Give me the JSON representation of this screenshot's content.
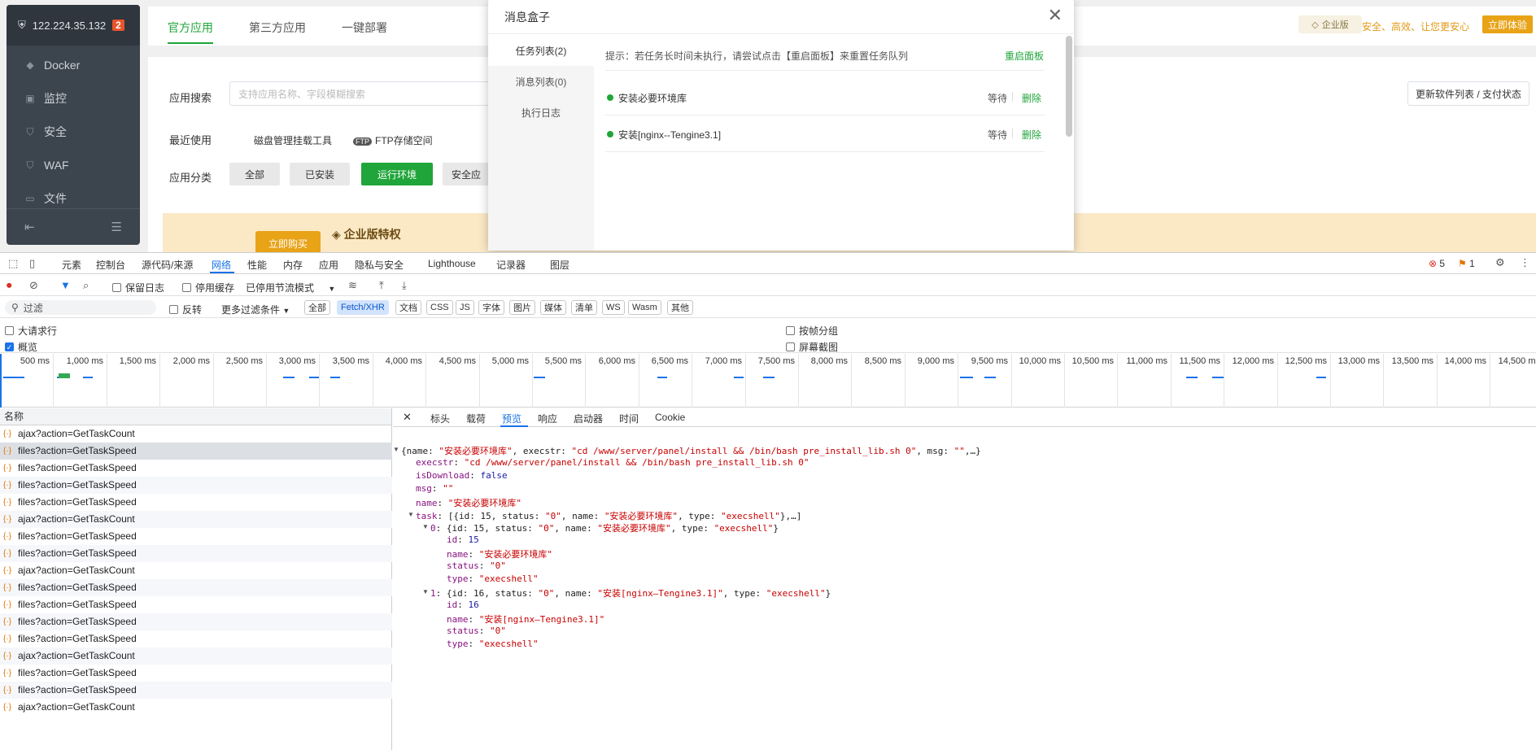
{
  "app": {
    "host": "122.224.35.132",
    "host_badge": "2",
    "nav": [
      "Docker",
      "监控",
      "安全",
      "WAF",
      "文件"
    ],
    "tabs": [
      "官方应用",
      "第三方应用",
      "一键部署"
    ],
    "ent_badge": "企业版",
    "ent_slogan": "安全、高效、让您更安心",
    "ent_button": "立即体验",
    "search_label": "应用搜索",
    "search_placeholder": "支持应用名称、字段模糊搜索",
    "update_button": "更新软件列表 / 支付状态",
    "recent_label": "最近使用",
    "recent": [
      "磁盘管理挂载工具",
      "FTP存储空间"
    ],
    "category_label": "应用分类",
    "categories": [
      "全部",
      "已安装",
      "运行环境",
      "安全应"
    ],
    "banner_title": "企业版特权",
    "banner_button": "立即购买"
  },
  "modal": {
    "title": "消息盒子",
    "tabs": [
      "任务列表(2)",
      "消息列表(0)",
      "执行日志"
    ],
    "tip": "提示：若任务长时间未执行，请尝试点击【重启面板】来重置任务队列",
    "restart": "重启面板",
    "tasks": [
      {
        "name": "安装必要环境库",
        "status": "等待",
        "action": "删除"
      },
      {
        "name": "安装[nginx--Tengine3.1]",
        "status": "等待",
        "action": "删除"
      }
    ]
  },
  "devtools": {
    "tabs": [
      "元素",
      "控制台",
      "源代码/来源",
      "网络",
      "性能",
      "内存",
      "应用",
      "隐私与安全",
      "Lighthouse",
      "记录器",
      "图层"
    ],
    "errors": "5",
    "warnings": "1",
    "toolbar": {
      "preserve_log": "保留日志",
      "disable_cache": "停用缓存",
      "throttle": "已停用节流模式"
    },
    "filter": {
      "placeholder": "过滤",
      "invert": "反转",
      "more": "更多过滤条件",
      "types": [
        "全部",
        "Fetch/XHR",
        "文档",
        "CSS",
        "JS",
        "字体",
        "图片",
        "媒体",
        "清单",
        "WS",
        "Wasm",
        "其他"
      ]
    },
    "options": {
      "big_rows": "大请求行",
      "overview": "概览",
      "group_frame": "按帧分组",
      "screenshots": "屏幕截图"
    },
    "timeline_labels": [
      "500 ms",
      "1,000 ms",
      "1,500 ms",
      "2,000 ms",
      "2,500 ms",
      "3,000 ms",
      "3,500 ms",
      "4,000 ms",
      "4,500 ms",
      "5,000 ms",
      "5,500 ms",
      "6,000 ms",
      "6,500 ms",
      "7,000 ms",
      "7,500 ms",
      "8,000 ms",
      "8,500 ms",
      "9,000 ms",
      "9,500 ms",
      "10,000 ms",
      "10,500 ms",
      "11,000 ms",
      "11,500 ms",
      "12,000 ms",
      "12,500 ms",
      "13,000 ms",
      "13,500 ms",
      "14,000 ms",
      "14,500 ms"
    ],
    "name_header": "名称",
    "requests": [
      "ajax?action=GetTaskCount",
      "files?action=GetTaskSpeed",
      "files?action=GetTaskSpeed",
      "files?action=GetTaskSpeed",
      "files?action=GetTaskSpeed",
      "ajax?action=GetTaskCount",
      "files?action=GetTaskSpeed",
      "files?action=GetTaskSpeed",
      "ajax?action=GetTaskCount",
      "files?action=GetTaskSpeed",
      "files?action=GetTaskSpeed",
      "files?action=GetTaskSpeed",
      "files?action=GetTaskSpeed",
      "ajax?action=GetTaskCount",
      "files?action=GetTaskSpeed",
      "files?action=GetTaskSpeed",
      "ajax?action=GetTaskCount"
    ],
    "preview_tabs": [
      "标头",
      "载荷",
      "预览",
      "响应",
      "启动器",
      "时间",
      "Cookie"
    ],
    "json_lines": [
      "{name: \"安装必要环境库\", execstr: \"cd /www/server/panel/install && /bin/bash pre_install_lib.sh 0\", msg: \"\",…}",
      "execstr: \"cd /www/server/panel/install && /bin/bash pre_install_lib.sh 0\"",
      "isDownload: false",
      "msg: \"\"",
      "name: \"安装必要环境库\"",
      "task: [{id: 15, status: \"0\", name: \"安装必要环境库\", type: \"execshell\"},…]",
      "0: {id: 15, status: \"0\", name: \"安装必要环境库\", type: \"execshell\"}",
      "id: 15",
      "name: \"安装必要环境库\"",
      "status: \"0\"",
      "type: \"execshell\"",
      "1: {id: 16, status: \"0\", name: \"安装[nginx—Tengine3.1]\", type: \"execshell\"}",
      "id: 16",
      "name: \"安装[nginx—Tengine3.1]\"",
      "status: \"0\"",
      "type: \"execshell\""
    ]
  }
}
